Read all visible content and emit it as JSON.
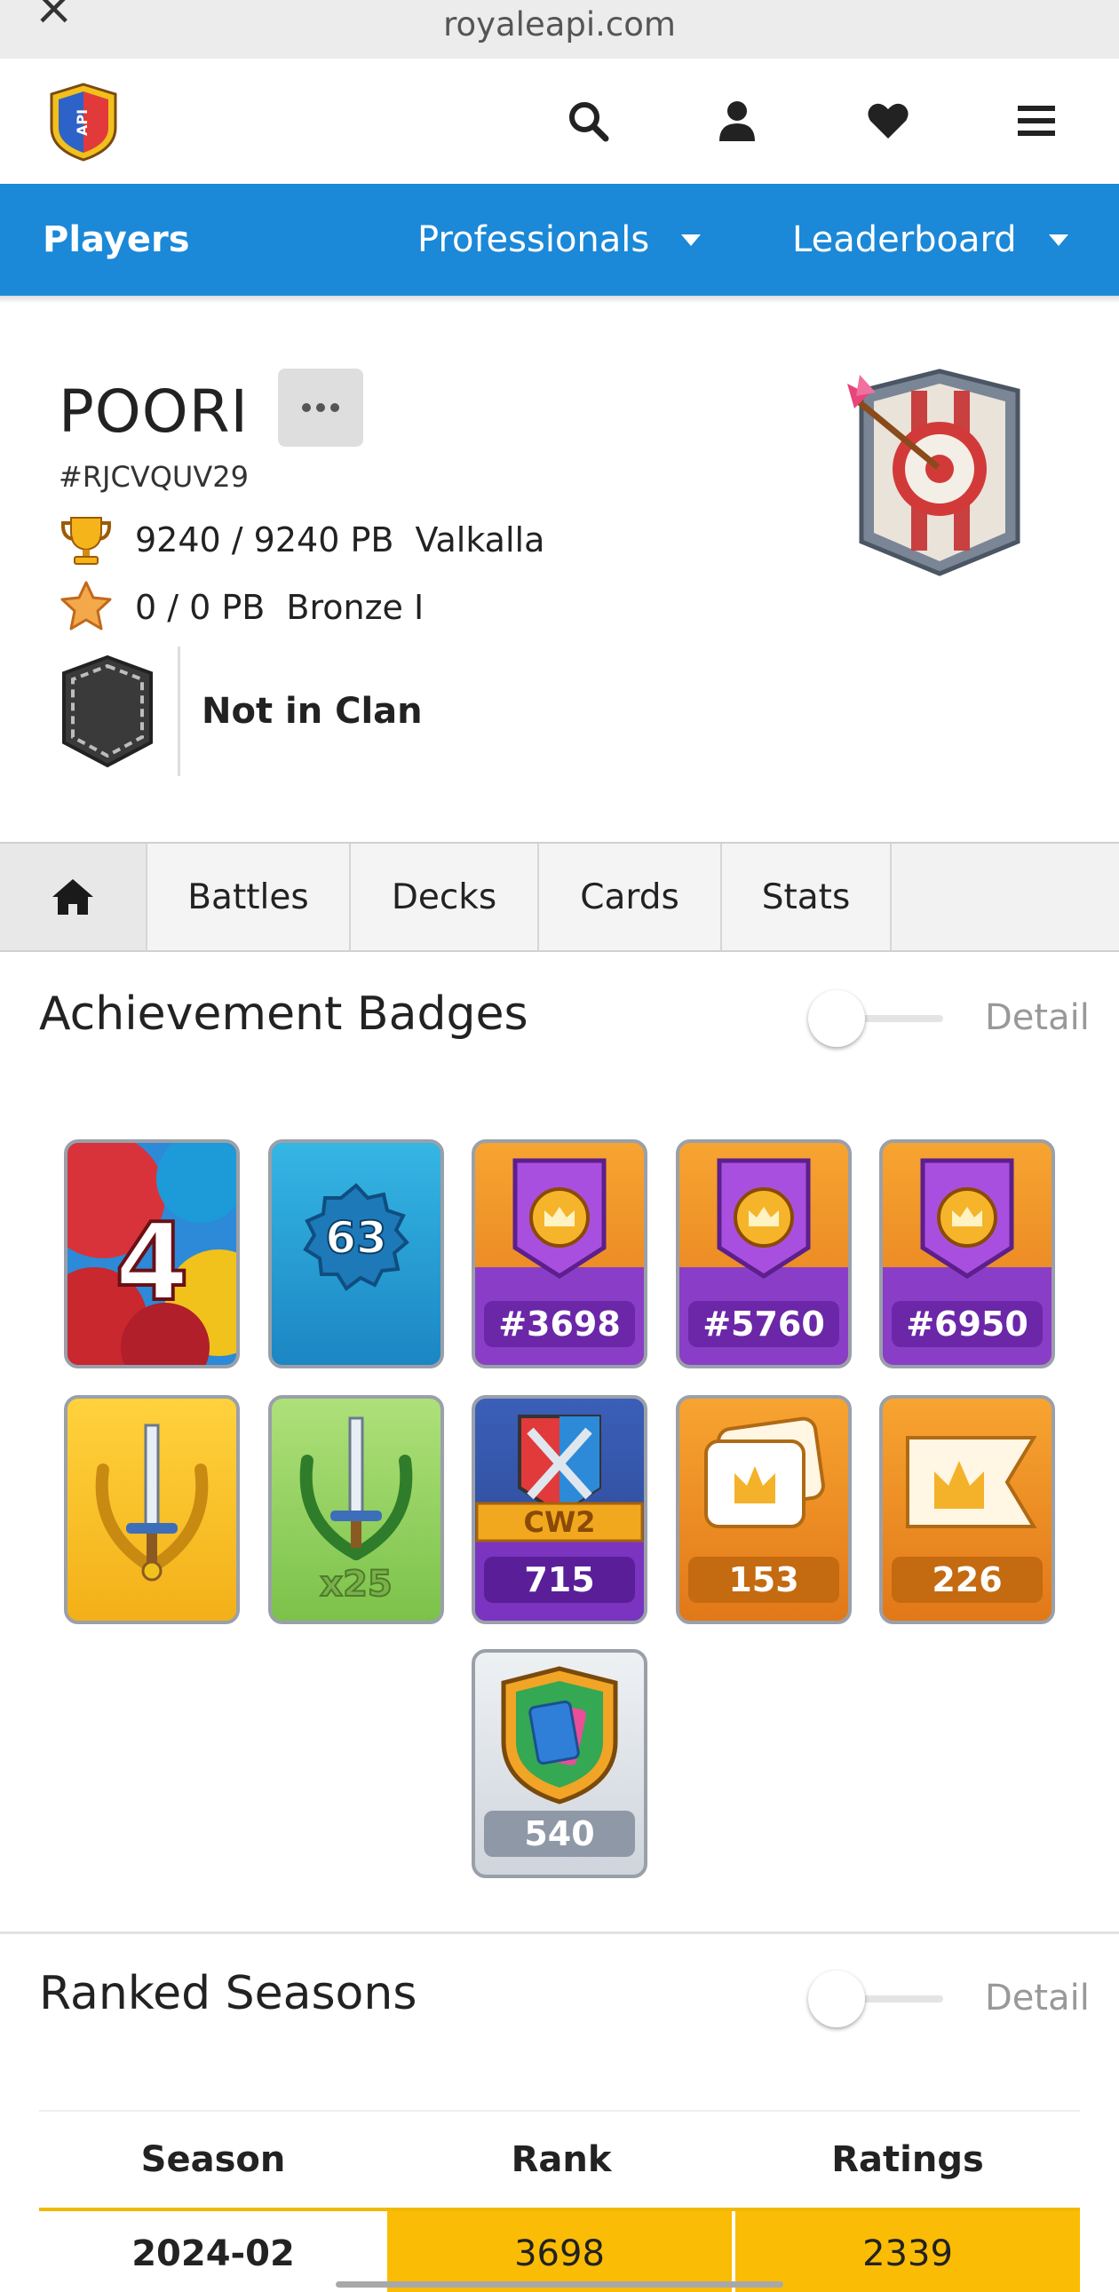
{
  "browser": {
    "url": "royaleapi.com",
    "close_icon": "close-icon"
  },
  "header": {
    "logo_text": "API",
    "icons": [
      "search-icon",
      "user-icon",
      "heart-icon",
      "menu-icon"
    ]
  },
  "nav": {
    "accent": "#1b88d8",
    "players": "Players",
    "professionals": "Professionals",
    "leaderboard": "Leaderboard"
  },
  "profile": {
    "name": "POORI",
    "tag": "#RJCVQUV29",
    "trophies": "9240 / 9240 PB",
    "arena": "Valkalla",
    "ranked": "0 / 0 PB",
    "league": "Bronze I",
    "clan": "Not in Clan"
  },
  "tabs": {
    "home_icon": "home-icon",
    "battles": "Battles",
    "decks": "Decks",
    "cards": "Cards",
    "stats": "Stats"
  },
  "achievements": {
    "title": "Achievement Badges",
    "detail": "Detail",
    "badges": [
      {
        "type": "years-played",
        "label": "4"
      },
      {
        "type": "exp-level",
        "label": "63"
      },
      {
        "type": "ladder-rank",
        "label": "#3698"
      },
      {
        "type": "ladder-rank",
        "label": "#5760"
      },
      {
        "type": "ladder-rank",
        "label": "#6950"
      },
      {
        "type": "sword-gold",
        "label": ""
      },
      {
        "type": "sword-green",
        "label": "x25"
      },
      {
        "type": "clan-wars",
        "tag": "CW2",
        "label": "715"
      },
      {
        "type": "crown-cards",
        "label": "153"
      },
      {
        "type": "crown-flag",
        "label": "226"
      },
      {
        "type": "card-collection",
        "label": "540"
      }
    ]
  },
  "ranked_seasons": {
    "title": "Ranked Seasons",
    "detail": "Detail",
    "columns": [
      "Season",
      "Rank",
      "Ratings"
    ],
    "rows": [
      {
        "season": "2024-02",
        "rank": "3698",
        "ratings": "2339"
      }
    ],
    "highlight_color": "#fbbc05"
  }
}
